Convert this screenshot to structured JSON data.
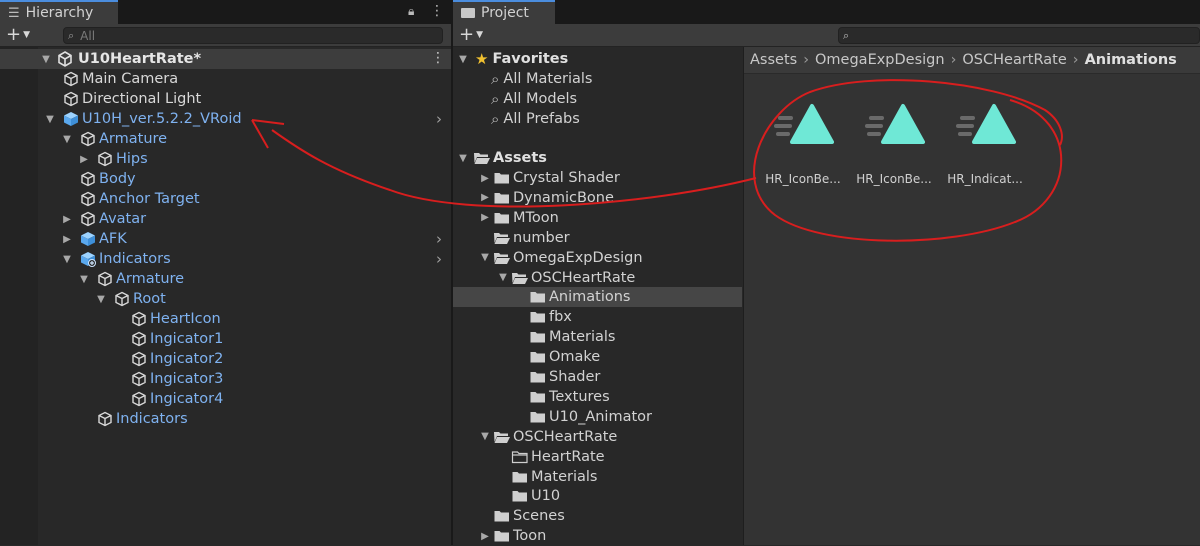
{
  "hierarchy": {
    "tab_label": "Hierarchy",
    "search_placeholder": "All",
    "scene": "U10HeartRate*",
    "items": [
      {
        "label": "Main Camera",
        "color": "white",
        "icon": "gameobject-icon"
      },
      {
        "label": "Directional Light",
        "color": "white",
        "icon": "gameobject-icon"
      },
      {
        "label": "U10H_ver.5.2.2_VRoid",
        "color": "blue",
        "icon": "prefab-icon",
        "fold": "open",
        "chev": true
      },
      {
        "label": "Armature",
        "color": "blue",
        "icon": "gameobject-icon",
        "fold": "open"
      },
      {
        "label": "Hips",
        "color": "blue",
        "icon": "gameobject-icon",
        "fold": "closed"
      },
      {
        "label": "Body",
        "color": "blue",
        "icon": "gameobject-icon"
      },
      {
        "label": "Anchor Target",
        "color": "blue",
        "icon": "gameobject-icon"
      },
      {
        "label": "Avatar",
        "color": "blue",
        "icon": "gameobject-icon",
        "fold": "closed"
      },
      {
        "label": "AFK",
        "color": "blue",
        "icon": "prefab-icon",
        "fold": "closed",
        "chev": true
      },
      {
        "label": "Indicators",
        "color": "blue",
        "icon": "prefab-variant-icon",
        "fold": "open",
        "chev": true
      },
      {
        "label": "Armature",
        "color": "blue",
        "icon": "gameobject-icon",
        "fold": "open"
      },
      {
        "label": "Root",
        "color": "blue",
        "icon": "gameobject-icon",
        "fold": "open"
      },
      {
        "label": "HeartIcon",
        "color": "blue",
        "icon": "gameobject-icon"
      },
      {
        "label": "Ingicator1",
        "color": "blue",
        "icon": "gameobject-icon"
      },
      {
        "label": "Ingicator2",
        "color": "blue",
        "icon": "gameobject-icon"
      },
      {
        "label": "Ingicator3",
        "color": "blue",
        "icon": "gameobject-icon"
      },
      {
        "label": "Ingicator4",
        "color": "blue",
        "icon": "gameobject-icon"
      },
      {
        "label": "Indicators",
        "color": "blue",
        "icon": "gameobject-icon"
      }
    ]
  },
  "project": {
    "tab_label": "Project",
    "favorites_label": "Favorites",
    "favorites": [
      "All Materials",
      "All Models",
      "All Prefabs"
    ],
    "assets_label": "Assets",
    "tree": [
      {
        "label": "Crystal Shader",
        "icon": "folder-icon",
        "fold": "closed"
      },
      {
        "label": "DynamicBone",
        "icon": "folder-icon",
        "fold": "closed"
      },
      {
        "label": "MToon",
        "icon": "folder-icon",
        "fold": "closed"
      },
      {
        "label": "number",
        "icon": "folder-open-icon"
      },
      {
        "label": "OmegaExpDesign",
        "icon": "folder-open-icon",
        "fold": "open"
      },
      {
        "label": "OSCHeartRate",
        "icon": "folder-open-icon",
        "fold": "open"
      },
      {
        "label": "Animations",
        "icon": "folder-icon",
        "selected": true
      },
      {
        "label": "fbx",
        "icon": "folder-icon"
      },
      {
        "label": "Materials",
        "icon": "folder-icon"
      },
      {
        "label": "Omake",
        "icon": "folder-icon"
      },
      {
        "label": "Shader",
        "icon": "folder-icon"
      },
      {
        "label": "Textures",
        "icon": "folder-icon"
      },
      {
        "label": "U10_Animator",
        "icon": "folder-icon"
      },
      {
        "label": "OSCHeartRate",
        "icon": "folder-open-icon",
        "fold": "open"
      },
      {
        "label": "HeartRate",
        "icon": "folder-empty-icon"
      },
      {
        "label": "Materials",
        "icon": "folder-icon"
      },
      {
        "label": "U10",
        "icon": "folder-icon"
      },
      {
        "label": "Scenes",
        "icon": "folder-icon"
      },
      {
        "label": "Toon",
        "icon": "folder-icon",
        "fold": "closed"
      }
    ],
    "breadcrumb": [
      "Assets",
      "OmegaExpDesign",
      "OSCHeartRate",
      "Animations"
    ],
    "assets": [
      "HR_IconBe...",
      "HR_IconBe...",
      "HR_Indicat..."
    ]
  },
  "colors": {
    "link_blue": "#7fb2f0",
    "anim_teal": "#6fe8d6",
    "annotation_red": "#d81e1e"
  }
}
